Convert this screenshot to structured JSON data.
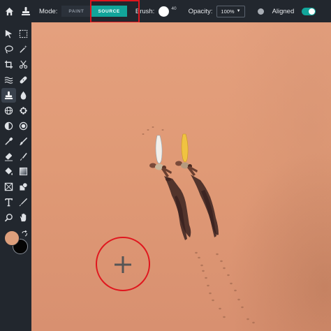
{
  "toolbar": {
    "mode_label": "Mode:",
    "mode_options": [
      {
        "label": "PAINT",
        "active": false
      },
      {
        "label": "SOURCE",
        "active": true
      }
    ],
    "brush_label": "Brush:",
    "brush_size": "40",
    "opacity_label": "Opacity:",
    "opacity_value": "100%",
    "aligned_label": "Aligned",
    "aligned_enabled": true
  },
  "colors": {
    "accent": "#12a59a",
    "highlight": "#e0161e",
    "foreground": "#dd9f7c",
    "background": "#050505"
  },
  "tools": [
    "move-icon",
    "marquee-icon",
    "lasso-icon",
    "magic-wand-icon",
    "crop-icon",
    "scissors-icon",
    "liquify-icon",
    "bandage-icon",
    "clone-stamp-icon",
    "drop-icon",
    "globe-icon",
    "sponge-icon",
    "dodge-icon",
    "burn-icon",
    "eyedropper-icon",
    "brush-icon",
    "eraser-icon",
    "smudge-icon",
    "paint-bucket-icon",
    "gradient-icon",
    "frame-icon",
    "shape-icon",
    "text-icon",
    "pen-icon",
    "zoom-icon",
    "hand-icon"
  ],
  "selected_tool": "clone-stamp-icon"
}
